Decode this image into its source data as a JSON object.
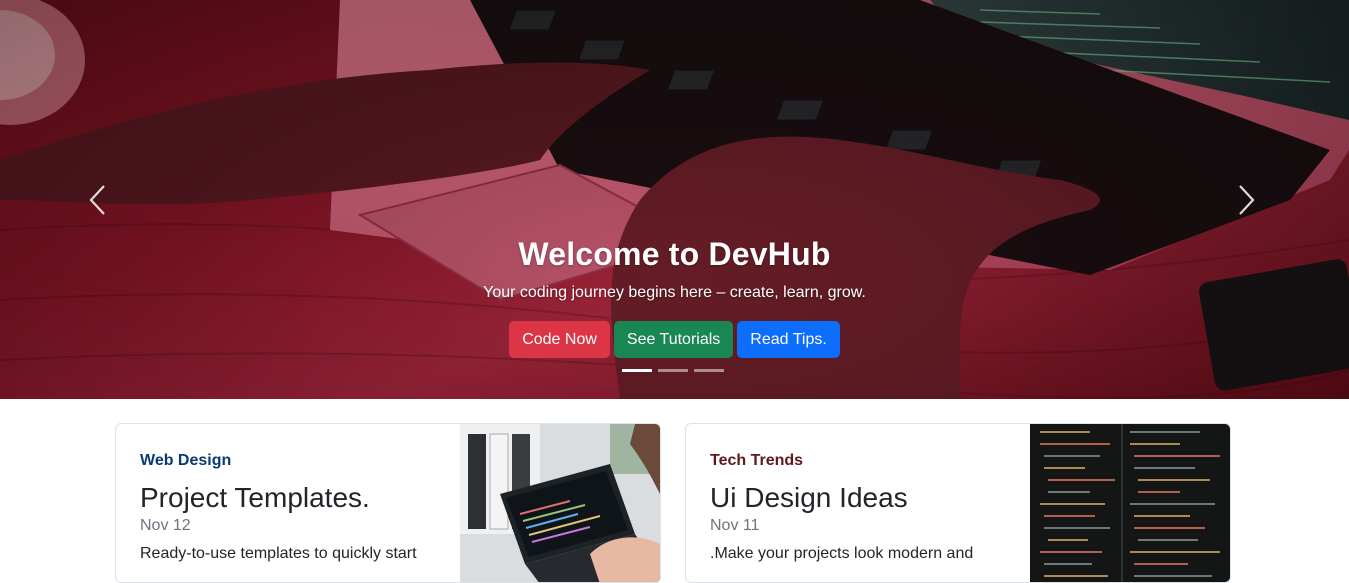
{
  "hero": {
    "title": "Welcome to DevHub",
    "subtitle": "Your coding journey begins here – create, learn, grow.",
    "buttons": [
      {
        "label": "Code Now",
        "color": "#dc3545"
      },
      {
        "label": "See Tutorials",
        "color": "#198754"
      },
      {
        "label": "Read Tips.",
        "color": "#0d6efd"
      }
    ],
    "controls": {
      "prev_icon": "chevron-left-icon",
      "next_icon": "chevron-right-icon"
    },
    "active_slide": 1,
    "slide_count": 3
  },
  "cards": [
    {
      "category": "Web Design",
      "category_color": "#0b3a73",
      "title": "Project Templates.",
      "date": "Nov 12",
      "description": "Ready-to-use templates to quickly start"
    },
    {
      "category": "Tech Trends",
      "category_color": "#5c1a1a",
      "title": "Ui Design Ideas",
      "date": "Nov 11",
      "description": ".Make your projects look modern and"
    }
  ]
}
